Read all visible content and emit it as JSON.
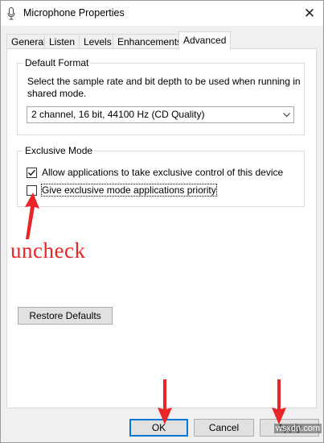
{
  "window": {
    "title": "Microphone Properties",
    "close_glyph": "✕"
  },
  "tabs": [
    {
      "label": "General"
    },
    {
      "label": "Listen"
    },
    {
      "label": "Levels"
    },
    {
      "label": "Enhancements"
    },
    {
      "label": "Advanced",
      "active": true
    }
  ],
  "default_format": {
    "legend": "Default Format",
    "description": "Select the sample rate and bit depth to be used when running in shared mode.",
    "selected": "2 channel, 16 bit, 44100 Hz (CD Quality)"
  },
  "exclusive_mode": {
    "legend": "Exclusive Mode",
    "options": [
      {
        "label": "Allow applications to take exclusive control of this device",
        "checked": true
      },
      {
        "label": "Give exclusive mode applications priority",
        "checked": false
      }
    ]
  },
  "annotation": {
    "text": "uncheck",
    "color": "#e8262a"
  },
  "buttons": {
    "restore_defaults": "Restore Defaults",
    "ok": "OK",
    "cancel": "Cancel",
    "apply": "Apply"
  },
  "watermark": "wsxdn.com",
  "colors": {
    "accent": "#0078d7",
    "annotation_red": "#e8262a"
  }
}
